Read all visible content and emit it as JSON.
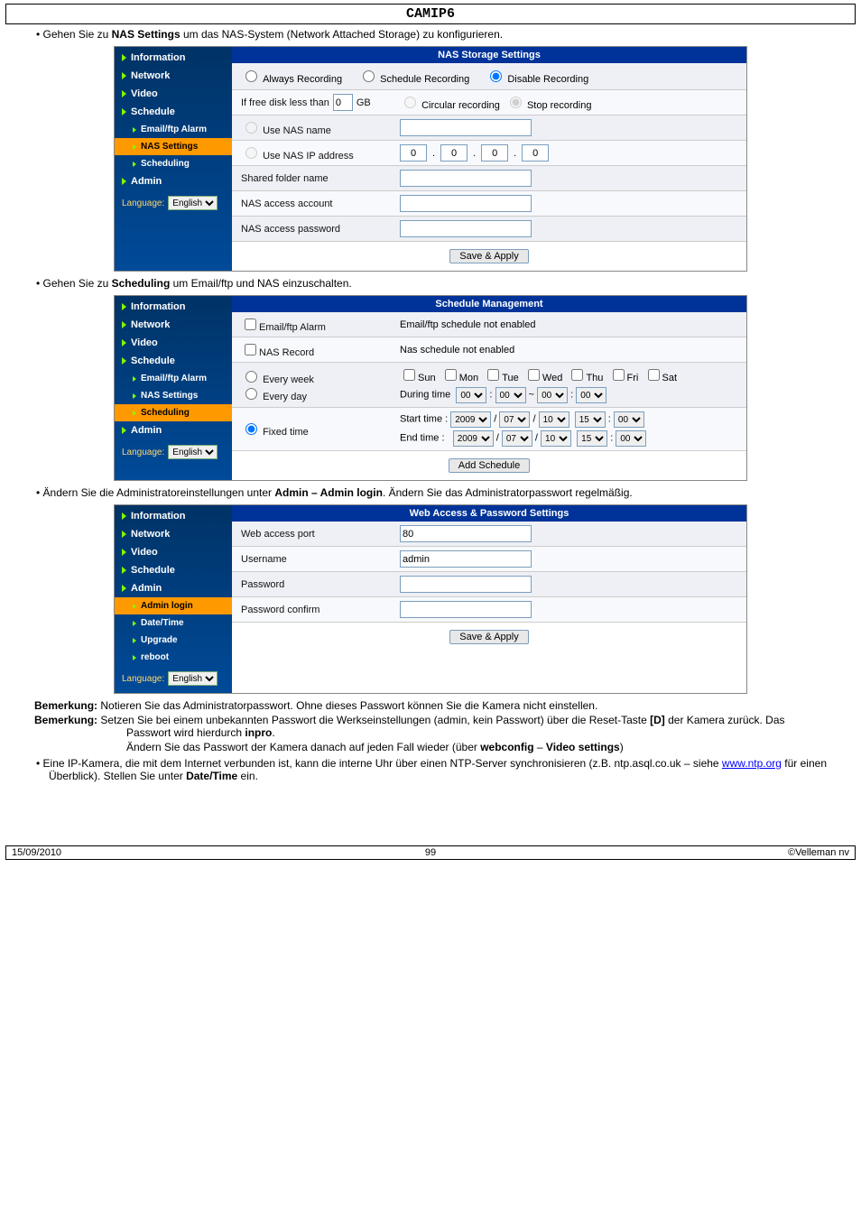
{
  "page_title": "CAMIP6",
  "bullets": {
    "b1_pre": "Gehen Sie zu ",
    "b1_bold": "NAS Settings",
    "b1_post": " um das NAS-System (Network Attached Storage) zu konfigurieren.",
    "b2_pre": "Gehen Sie zu ",
    "b2_bold": "Scheduling",
    "b2_post": " um Email/ftp und NAS einzuschalten.",
    "b3_pre": "Ändern Sie die Administratoreinstellungen unter ",
    "b3_bold": "Admin – Admin login",
    "b3_post": ". Ändern Sie das Administratorpasswort regelmäßig.",
    "b4_text": "Eine IP-Kamera, die mit dem Internet verbunden ist, kann die interne Uhr über einen NTP-Server synchronisieren (z.B. ntp.asql.co.uk – siehe ",
    "b4_link": "www.ntp.org",
    "b4_after": " für einen Überblick). Stellen Sie unter ",
    "b4_bold": "Date/Time",
    "b4_end": " ein."
  },
  "sidebar": {
    "info": "Information",
    "network": "Network",
    "video": "Video",
    "schedule": "Schedule",
    "emailftp": "Email/ftp Alarm",
    "nas": "NAS Settings",
    "scheduling": "Scheduling",
    "admin": "Admin",
    "adminlogin": "Admin login",
    "datetime": "Date/Time",
    "upgrade": "Upgrade",
    "reboot": "reboot",
    "lang_label": "Language:",
    "lang_value": "English"
  },
  "panel1": {
    "header": "NAS Storage Settings",
    "always": "Always Recording",
    "schedrec": "Schedule Recording",
    "disable": "Disable Recording",
    "freedisk_pre": "If free disk less than",
    "freedisk_val": "0",
    "gb": "GB",
    "circular": "Circular recording",
    "stop": "Stop recording",
    "usenas": "Use NAS name",
    "useip": "Use NAS IP address",
    "ip0": "0",
    "shared": "Shared folder name",
    "account": "NAS access account",
    "password": "NAS access password",
    "save": "Save & Apply"
  },
  "panel2": {
    "header": "Schedule Management",
    "emailftp": "Email/ftp Alarm",
    "emailftp_msg": "Email/ftp schedule not enabled",
    "nasrec": "NAS Record",
    "nasrec_msg": "Nas schedule not enabled",
    "everyweek": "Every week",
    "everyday": "Every day",
    "sun": "Sun",
    "mon": "Mon",
    "tue": "Tue",
    "wed": "Wed",
    "thu": "Thu",
    "fri": "Fri",
    "sat": "Sat",
    "during": "During time",
    "t00": "00",
    "fixed": "Fixed time",
    "start": "Start time :",
    "end": "End time :",
    "y2009": "2009",
    "m07": "07",
    "d10": "10",
    "h15": "15",
    "mn00": "00",
    "add": "Add Schedule"
  },
  "panel3": {
    "header": "Web Access & Password Settings",
    "webport": "Web access port",
    "webport_val": "80",
    "username": "Username",
    "username_val": "admin",
    "password": "Password",
    "confirm": "Password confirm",
    "save": "Save & Apply"
  },
  "remarks": {
    "label": "Bemerkung:",
    "r1": " Notieren Sie das Administratorpasswort. Ohne dieses Passwort können Sie die Kamera nicht einstellen.",
    "r2_a": " Setzen Sie bei einem unbekannten Passwort die Werkseinstellungen (admin, kein Passwort) über die Reset-Taste ",
    "r2_b": "[D]",
    "r2_c": " der Kamera zurück. Das Passwort wird hierdurch ",
    "r2_d": "inpro",
    "r2_e": ".",
    "r2_line2_a": "Ändern Sie das Passwort der Kamera danach auf jeden Fall wieder (über ",
    "r2_line2_b": "webconfig",
    "r2_line2_c": " – ",
    "r2_line2_d": "Video settings",
    "r2_line2_e": ")"
  },
  "footer": {
    "left": "15/09/2010",
    "center": "99",
    "right": "©Velleman nv"
  }
}
